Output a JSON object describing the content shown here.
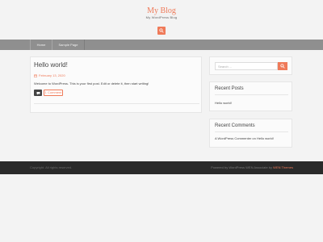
{
  "site": {
    "title": "My Blog",
    "description": "My WordPress Blog"
  },
  "nav": {
    "items": [
      {
        "label": "Home"
      },
      {
        "label": "Sample Page"
      }
    ]
  },
  "post": {
    "title": "Hello world!",
    "date": "February 13, 2020",
    "excerpt": "Welcome to WordPress. This is your first post. Edit or delete it, then start writing!",
    "comment_label": "1 Comment"
  },
  "sidebar": {
    "search": {
      "placeholder": "Search ..."
    },
    "recent_posts": {
      "title": "Recent Posts",
      "items": [
        "Hello world!"
      ]
    },
    "recent_comments": {
      "title": "Recent Comments",
      "items": [
        "A WordPress Commenter on Hello world!"
      ]
    }
  },
  "footer": {
    "left": "Copyright. All rights reserved.",
    "right_prefix": "Powered by WordPress WEN Associate by",
    "right_accent": "WEN Themes"
  },
  "colors": {
    "accent": "#ef7a59",
    "nav_bg": "#8f8f8f",
    "footer_bg": "#2a2a2a"
  },
  "icons": {
    "header_search": "search-icon",
    "date": "calendar-icon",
    "comment": "comment-icon",
    "sidebar_search": "search-icon"
  }
}
